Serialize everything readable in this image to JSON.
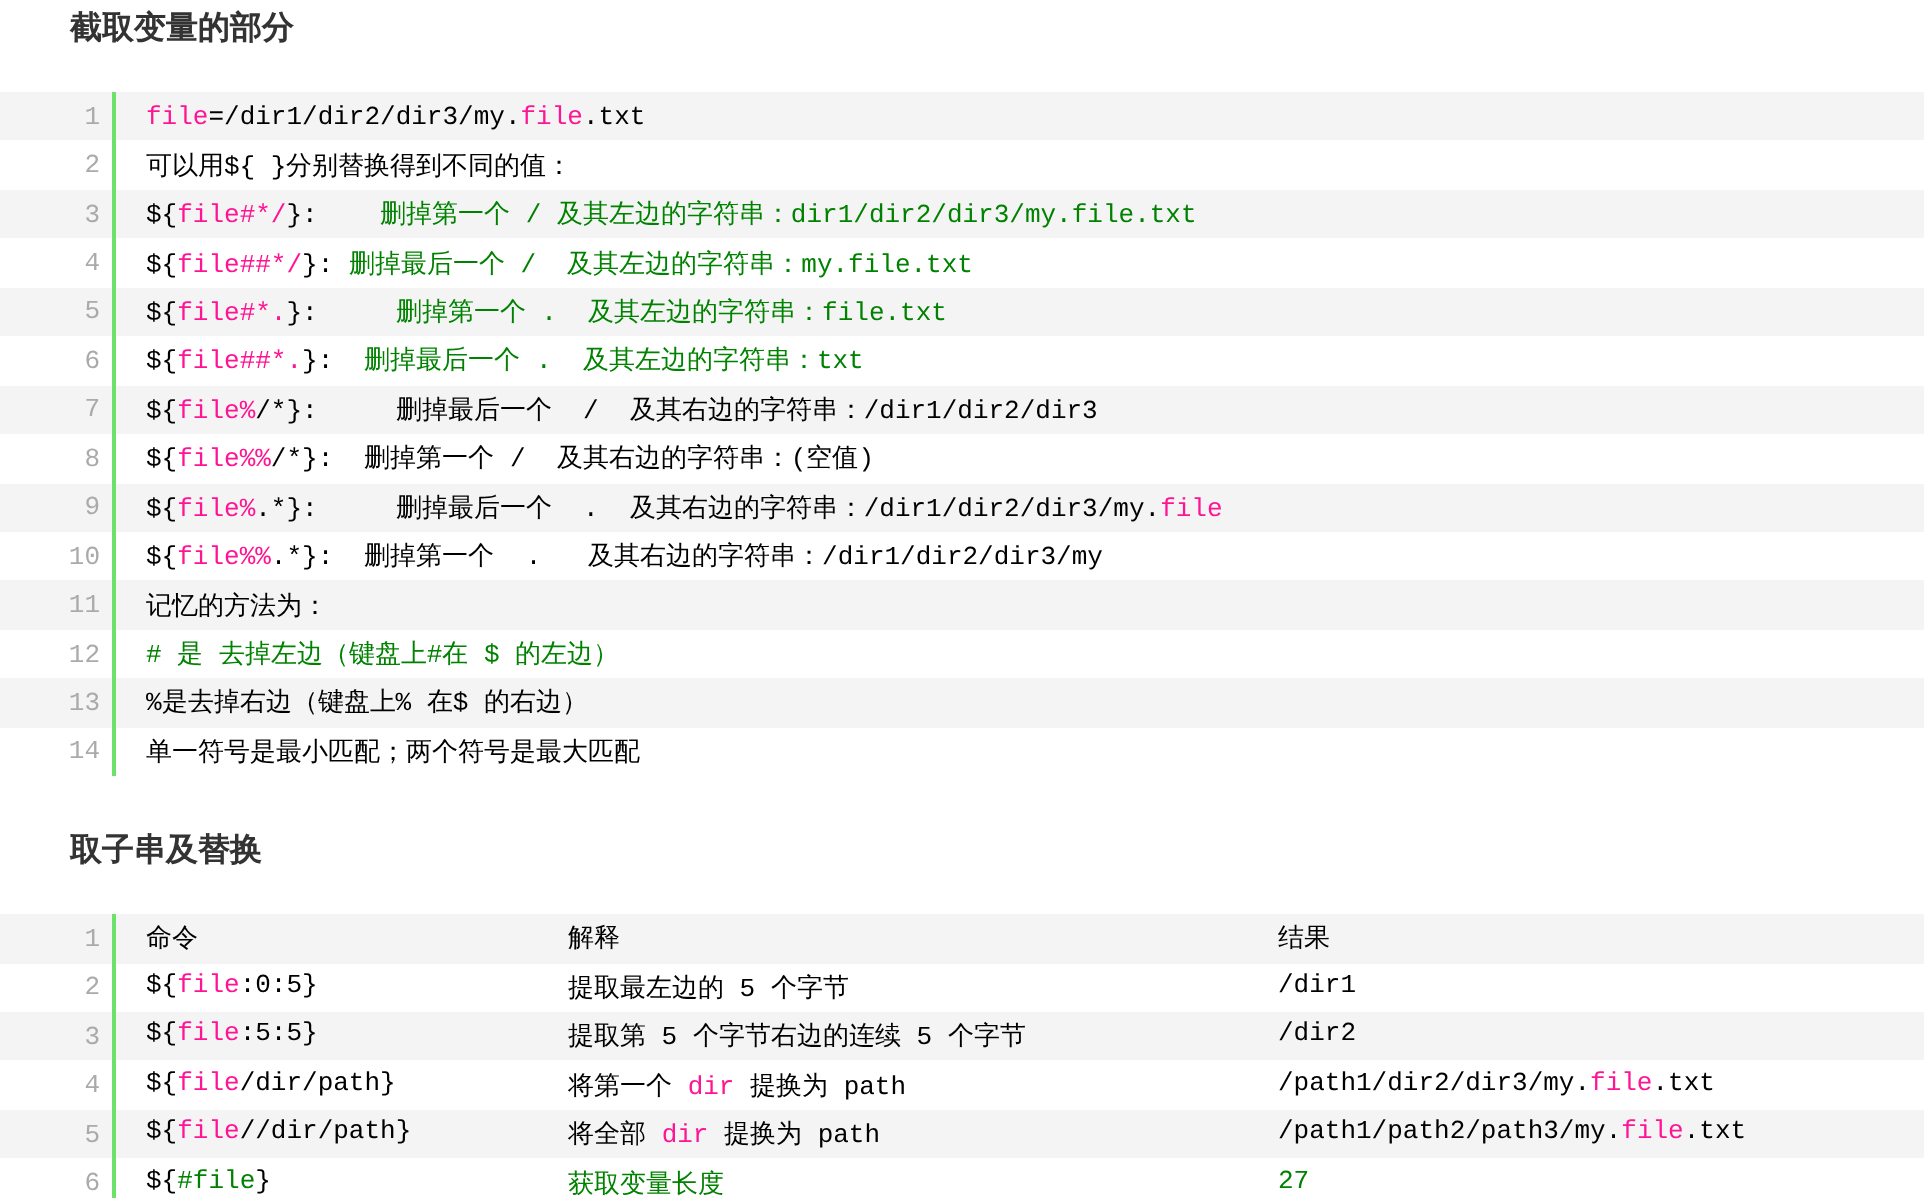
{
  "sections": [
    {
      "title": "截取变量的部分",
      "kind": "lines",
      "rows": [
        {
          "number": "1",
          "segments": [
            {
              "text": "file",
              "kind": "keyword"
            },
            {
              "text": "=/dir1/dir2/dir3/my.",
              "kind": "plain"
            },
            {
              "text": "file",
              "kind": "keyword"
            },
            {
              "text": ".txt",
              "kind": "plain"
            }
          ]
        },
        {
          "number": "2",
          "segments": [
            {
              "text": "可以用${ }分别替换得到不同的值：",
              "kind": "plain"
            }
          ]
        },
        {
          "number": "3",
          "segments": [
            {
              "text": "${",
              "kind": "plain"
            },
            {
              "text": "file#*/",
              "kind": "keyword"
            },
            {
              "text": "}:",
              "kind": "plain"
            },
            {
              "text": "    删掉第一个 / 及其左边的字符串：dir1/dir2/dir3/my.file.txt",
              "kind": "string"
            }
          ]
        },
        {
          "number": "4",
          "segments": [
            {
              "text": "${",
              "kind": "plain"
            },
            {
              "text": "file##*/",
              "kind": "keyword"
            },
            {
              "text": "}:",
              "kind": "plain"
            },
            {
              "text": " 删掉最后一个 /  及其左边的字符串：my.file.txt",
              "kind": "string"
            }
          ]
        },
        {
          "number": "5",
          "segments": [
            {
              "text": "${",
              "kind": "plain"
            },
            {
              "text": "file#*.",
              "kind": "keyword"
            },
            {
              "text": "}:",
              "kind": "plain"
            },
            {
              "text": "     删掉第一个 .  及其左边的字符串：file.txt",
              "kind": "string"
            }
          ]
        },
        {
          "number": "6",
          "segments": [
            {
              "text": "${",
              "kind": "plain"
            },
            {
              "text": "file##*.",
              "kind": "keyword"
            },
            {
              "text": "}:",
              "kind": "plain"
            },
            {
              "text": "  删掉最后一个 .  及其左边的字符串：txt",
              "kind": "string"
            }
          ]
        },
        {
          "number": "7",
          "segments": [
            {
              "text": "${",
              "kind": "plain"
            },
            {
              "text": "file%",
              "kind": "keyword"
            },
            {
              "text": "/*}:     删掉最后一个  /  及其右边的字符串：/dir1/dir2/dir3",
              "kind": "plain"
            }
          ]
        },
        {
          "number": "8",
          "segments": [
            {
              "text": "${",
              "kind": "plain"
            },
            {
              "text": "file%%",
              "kind": "keyword"
            },
            {
              "text": "/*}:  删掉第一个 /  及其右边的字符串：(空值)",
              "kind": "plain"
            }
          ]
        },
        {
          "number": "9",
          "segments": [
            {
              "text": "${",
              "kind": "plain"
            },
            {
              "text": "file%",
              "kind": "keyword"
            },
            {
              "text": ".*}:     删掉最后一个  .  及其右边的字符串：/dir1/dir2/dir3/my.",
              "kind": "plain"
            },
            {
              "text": "file",
              "kind": "keyword"
            }
          ]
        },
        {
          "number": "10",
          "segments": [
            {
              "text": "${",
              "kind": "plain"
            },
            {
              "text": "file%%",
              "kind": "keyword"
            },
            {
              "text": ".*}:  删掉第一个  .   及其右边的字符串：/dir1/dir2/dir3/my",
              "kind": "plain"
            }
          ]
        },
        {
          "number": "11",
          "segments": [
            {
              "text": "记忆的方法为：",
              "kind": "plain"
            }
          ]
        },
        {
          "number": "12",
          "segments": [
            {
              "text": "# 是 去掉左边（键盘上#在 $ 的左边）",
              "kind": "string"
            }
          ]
        },
        {
          "number": "13",
          "segments": [
            {
              "text": "%是去掉右边（键盘上% 在$ 的右边）",
              "kind": "plain"
            }
          ]
        },
        {
          "number": "14",
          "segments": [
            {
              "text": "单一符号是最小匹配；两个符号是最大匹配",
              "kind": "plain"
            }
          ]
        }
      ]
    },
    {
      "title": "取子串及替换",
      "kind": "table",
      "rows": [
        {
          "number": "1",
          "cells": [
            [
              {
                "text": "命令",
                "kind": "plain"
              }
            ],
            [
              {
                "text": "解释",
                "kind": "plain"
              }
            ],
            [
              {
                "text": "结果",
                "kind": "plain"
              }
            ]
          ]
        },
        {
          "number": "2",
          "cells": [
            [
              {
                "text": "${",
                "kind": "plain"
              },
              {
                "text": "file",
                "kind": "keyword"
              },
              {
                "text": ":0:5}",
                "kind": "plain"
              }
            ],
            [
              {
                "text": "提取最左边的 5 个字节",
                "kind": "plain"
              }
            ],
            [
              {
                "text": "/dir1",
                "kind": "plain"
              }
            ]
          ]
        },
        {
          "number": "3",
          "cells": [
            [
              {
                "text": "${",
                "kind": "plain"
              },
              {
                "text": "file",
                "kind": "keyword"
              },
              {
                "text": ":5:5}",
                "kind": "plain"
              }
            ],
            [
              {
                "text": "提取第 5 个字节右边的连续 5 个字节",
                "kind": "plain"
              }
            ],
            [
              {
                "text": "/dir2",
                "kind": "plain"
              }
            ]
          ]
        },
        {
          "number": "4",
          "cells": [
            [
              {
                "text": "${",
                "kind": "plain"
              },
              {
                "text": "file",
                "kind": "keyword"
              },
              {
                "text": "/dir/path}",
                "kind": "plain"
              }
            ],
            [
              {
                "text": "将第一个 ",
                "kind": "plain"
              },
              {
                "text": "dir",
                "kind": "keyword"
              },
              {
                "text": " 提换为 path",
                "kind": "plain"
              }
            ],
            [
              {
                "text": "/path1/dir2/dir3/my.",
                "kind": "plain"
              },
              {
                "text": "file",
                "kind": "keyword"
              },
              {
                "text": ".txt",
                "kind": "plain"
              }
            ]
          ]
        },
        {
          "number": "5",
          "cells": [
            [
              {
                "text": "${",
                "kind": "plain"
              },
              {
                "text": "file",
                "kind": "keyword"
              },
              {
                "text": "//dir/path}",
                "kind": "plain"
              }
            ],
            [
              {
                "text": "将全部 ",
                "kind": "plain"
              },
              {
                "text": "dir",
                "kind": "keyword"
              },
              {
                "text": " 提换为 path",
                "kind": "plain"
              }
            ],
            [
              {
                "text": "/path1/path2/path3/my.",
                "kind": "plain"
              },
              {
                "text": "file",
                "kind": "keyword"
              },
              {
                "text": ".txt",
                "kind": "plain"
              }
            ]
          ]
        },
        {
          "number": "6",
          "cells": [
            [
              {
                "text": "${",
                "kind": "plain"
              },
              {
                "text": "#file",
                "kind": "string"
              },
              {
                "text": "}",
                "kind": "plain"
              }
            ],
            [
              {
                "text": "获取变量长度",
                "kind": "string"
              }
            ],
            [
              {
                "text": "27",
                "kind": "string"
              }
            ]
          ]
        }
      ]
    }
  ]
}
